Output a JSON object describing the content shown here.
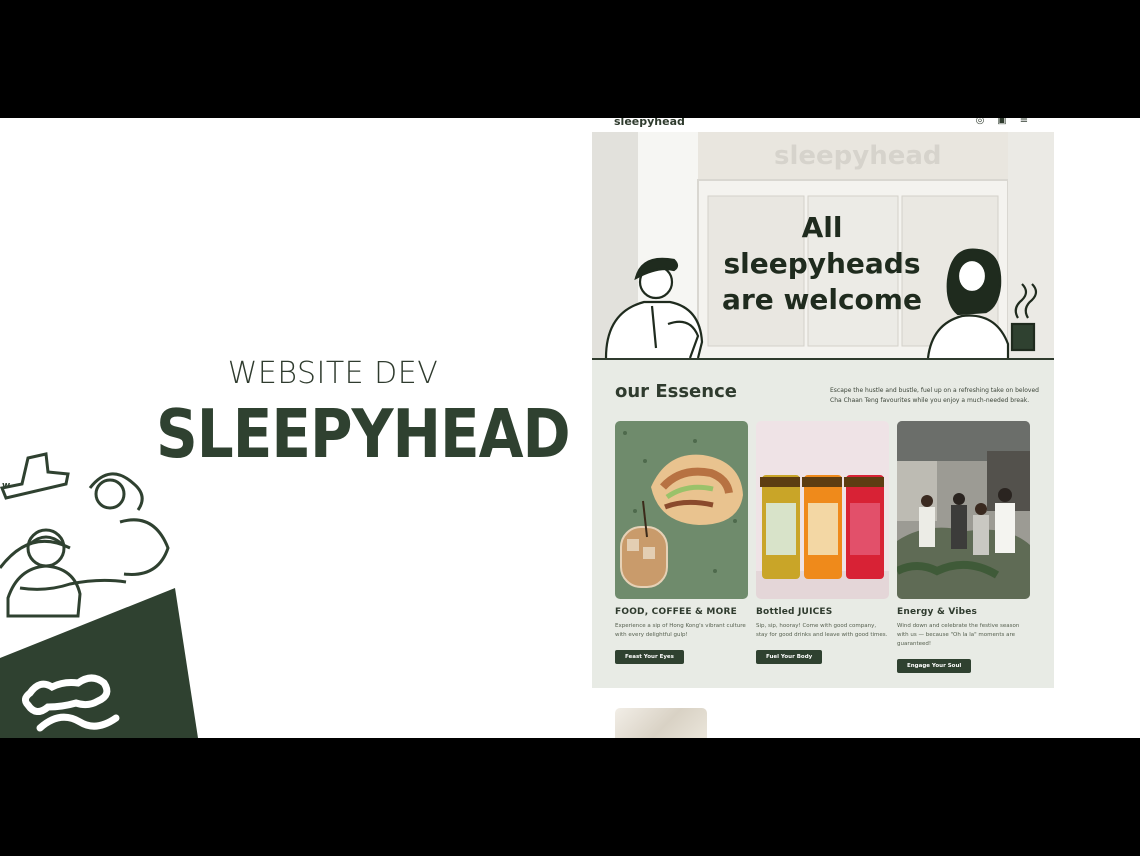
{
  "slide": {
    "kicker": "WEBSITE DEV",
    "title": "SLEEPYHEAD"
  },
  "site": {
    "logo": "sleepyhead",
    "nav_icons": [
      "user-icon",
      "cart-icon",
      "menu-icon"
    ],
    "hero": {
      "title_line1": "All sleepyheads",
      "title_line2": "are welcome",
      "storefront_sign": "sleepyhead"
    },
    "essence": {
      "title": "our Essence",
      "description": "Escape the hustle and bustle, fuel up on a refreshing take on beloved Cha Chaan Teng favourites while you enjoy a much-needed break.",
      "cards": [
        {
          "title": "FOOD, COFFEE & MORE",
          "text": "Experience a sip of Hong Kong's vibrant culture with every delightful gulp!",
          "button": "Feast Your Eyes"
        },
        {
          "title": "Bottled JUICES",
          "text": "Sip, sip, hooray! Come with good company, stay for good drinks and leave with good times.",
          "button": "Fuel Your Body"
        },
        {
          "title": "Energy & Vibes",
          "text": "Wind down and celebrate the festive season with us — because \"Oh la la\" moments are guaranteed!",
          "button": "Engage Your Soul"
        }
      ]
    }
  },
  "colors": {
    "brand_green": "#2f4130",
    "essence_bg": "#e8ebe5",
    "letterbox": "#000000"
  }
}
